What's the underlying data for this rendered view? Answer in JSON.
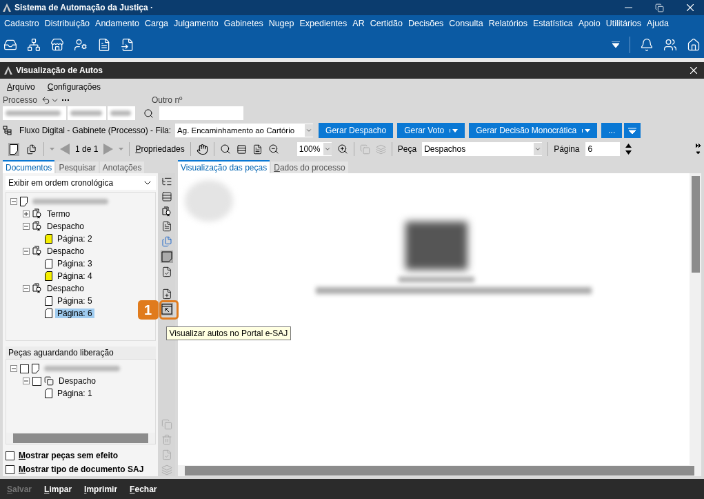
{
  "app": {
    "title": "Sistema de Automação da Justiça ·"
  },
  "menu": [
    "Cadastro",
    "Distribuição",
    "Andamento",
    "Carga",
    "Julgamento",
    "Gabinetes",
    "Nugep",
    "Expedientes",
    "AR",
    "Certidão",
    "Decisões",
    "Consulta",
    "Relatórios",
    "Estatística",
    "Apoio",
    "Utilitários",
    "Ajuda"
  ],
  "window": {
    "title": "Visualização de Autos"
  },
  "window_menu": [
    {
      "label": "Arquivo",
      "mnemonic": true
    },
    {
      "label": "Configurações",
      "mnemonic": true
    }
  ],
  "process": {
    "label": "Processo",
    "other_label": "Outro nº"
  },
  "flow": {
    "label": "Fluxo Digital - Gabinete (Processo) - Fila:",
    "queue": "Ag. Encaminhamento ao Cartório",
    "buttons": [
      {
        "label": "Gerar Despacho",
        "has_menu": false
      },
      {
        "label": "Gerar Voto",
        "has_menu": true
      },
      {
        "label": "Gerar Decisão Monocrática",
        "has_menu": true
      },
      {
        "label": "...",
        "has_menu": false
      }
    ]
  },
  "toolbar": {
    "pages": "1 de 1",
    "properties": "Propriedades",
    "zoom": "100%",
    "piece_label": "Peça",
    "piece": "Despachos",
    "page_label": "Página",
    "page": "6"
  },
  "left_tabs": [
    {
      "label": "Documentos",
      "selected": true
    },
    {
      "label": "Pesquisar",
      "selected": false
    },
    {
      "label": "Anotações",
      "selected": false
    }
  ],
  "order": "Exibir em ordem cronológica",
  "tree": [
    {
      "kind": "process",
      "expanded": true,
      "selected": false,
      "children": [
        {
          "kind": "piece",
          "label": "Termo",
          "expanded": false,
          "selected": false
        },
        {
          "kind": "piece",
          "label": "Despacho",
          "expanded": true,
          "selected": false,
          "children": [
            {
              "kind": "page",
              "label": "Página: 2",
              "marked": true,
              "selected": false
            }
          ]
        },
        {
          "kind": "piece",
          "label": "Despacho",
          "expanded": true,
          "selected": false,
          "children": [
            {
              "kind": "page",
              "label": "Página: 3",
              "marked": false,
              "selected": false
            },
            {
              "kind": "page",
              "label": "Página: 4",
              "marked": true,
              "selected": false
            }
          ]
        },
        {
          "kind": "piece",
          "label": "Despacho",
          "expanded": true,
          "selected": false,
          "children": [
            {
              "kind": "page",
              "label": "Página: 5",
              "marked": false,
              "selected": false
            },
            {
              "kind": "page",
              "label": "Página: 6",
              "marked": false,
              "selected": true
            }
          ]
        }
      ]
    }
  ],
  "pending": {
    "title": "Peças aguardando liberação",
    "tree": [
      {
        "kind": "process",
        "expanded": true,
        "checked": false,
        "children": [
          {
            "kind": "draft",
            "label": "Despacho",
            "expanded": true,
            "checked": false,
            "children": [
              {
                "kind": "page",
                "label": "Página: 1"
              }
            ]
          }
        ]
      }
    ]
  },
  "options": [
    {
      "label": "Mostrar peças sem efeito",
      "checked": false
    },
    {
      "label": "Mostrar tipo de documento SAJ",
      "checked": false
    }
  ],
  "view_tabs": [
    {
      "label": "Visualização das peças",
      "selected": true,
      "mnemonic": false
    },
    {
      "label": "Dados do processo",
      "selected": false,
      "mnemonic": true
    }
  ],
  "callout": {
    "badge": "1",
    "tooltip": "Visualizar autos no Portal e-SAJ"
  },
  "footer": [
    {
      "label": "Salvar",
      "disabled": true
    },
    {
      "label": "Limpar",
      "disabled": false
    },
    {
      "label": "Imprimir",
      "disabled": false
    },
    {
      "label": "Fechar",
      "disabled": false
    }
  ]
}
